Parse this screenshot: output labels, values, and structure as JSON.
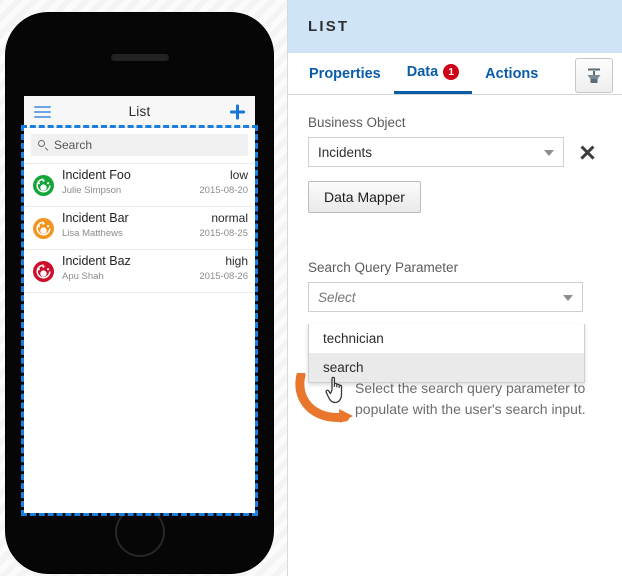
{
  "device_preview": {
    "app_bar": {
      "menu_icon": "hamburger-menu-icon",
      "title": "List",
      "add_icon": "plus-icon"
    },
    "search": {
      "icon": "search-icon",
      "placeholder": "Search"
    },
    "rows": [
      {
        "icon": "gauge-icon",
        "icon_color": "#13a538",
        "title": "Incident Foo",
        "priority": "low",
        "user": "Julie Simpson",
        "date": "2015-08-20"
      },
      {
        "icon": "gauge-icon",
        "icon_color": "#f2941f",
        "title": "Incident Bar",
        "priority": "normal",
        "user": "Lisa Matthews",
        "date": "2015-08-25"
      },
      {
        "icon": "gauge-icon",
        "icon_color": "#ce0e2d",
        "title": "Incident Baz",
        "priority": "high",
        "user": "Apu Shah",
        "date": "2015-08-26"
      }
    ],
    "selection_color": "#1b7fe0"
  },
  "panel": {
    "title": "LIST",
    "header_bg": "#cfe4f7",
    "accent_color": "#0a5ca8",
    "badge_color": "#d00017",
    "tabs": [
      {
        "label": "Properties",
        "active": false,
        "badge": null
      },
      {
        "label": "Data",
        "active": true,
        "badge": "1"
      },
      {
        "label": "Actions",
        "active": false,
        "badge": null
      }
    ],
    "tool_button_icon": "collapse-into-box-icon",
    "business_object": {
      "label": "Business Object",
      "value": "Incidents",
      "placeholder": "Select",
      "clear_icon": "close-x-icon",
      "caret_icon": "chevron-down-icon"
    },
    "data_mapper_button": "Data Mapper",
    "search_query_parameter": {
      "label": "Search Query Parameter",
      "value": "Select",
      "caret_icon": "chevron-down-icon",
      "options": [
        {
          "label": "technician",
          "highlighted": false
        },
        {
          "label": "search",
          "highlighted": true
        }
      ]
    },
    "hint": {
      "text": "Select the search query parameter to populate with the user's search input.",
      "arrow_color": "#e8762c",
      "arrow_icon": "curved-arrow-icon",
      "cursor_icon": "hand-pointer-cursor"
    }
  }
}
